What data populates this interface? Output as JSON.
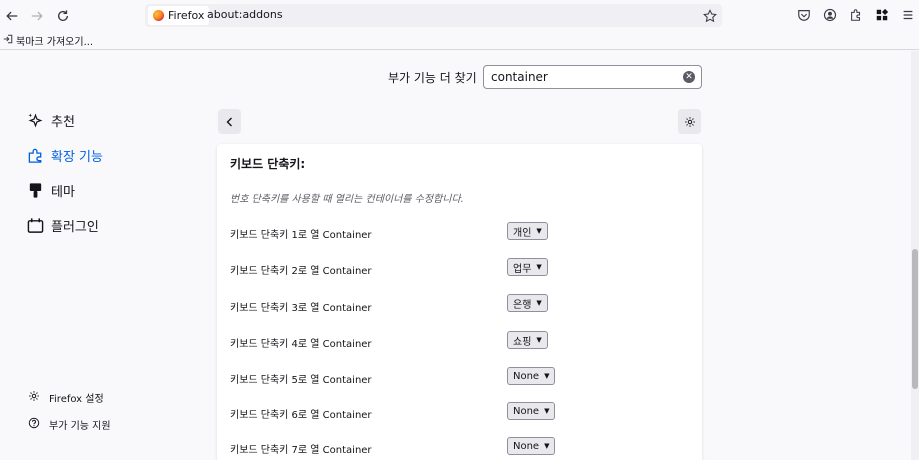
{
  "browser": {
    "identity_label": "Firefox",
    "url": "about:addons",
    "bookmark_item": "북마크 가져오기..."
  },
  "search": {
    "label": "부가 기능 더 찾기",
    "value": "container"
  },
  "sidebar": {
    "categories": [
      {
        "label": "추천",
        "icon": "sparkle-icon"
      },
      {
        "label": "확장 기능",
        "icon": "puzzle-icon",
        "active": true
      },
      {
        "label": "테마",
        "icon": "brush-icon"
      },
      {
        "label": "플러그인",
        "icon": "plugin-icon"
      }
    ],
    "footer": [
      {
        "label": "Firefox 설정",
        "icon": "gear-icon"
      },
      {
        "label": "부가 기능 지원",
        "icon": "help-icon"
      }
    ]
  },
  "card": {
    "title": "키보드 단축키:",
    "description": "번호 단축키를 사용할 때 열리는 컨테이너를 수정합니다.",
    "rows": [
      {
        "label": "키보드 단축키 1로 열 Container",
        "value": "개인"
      },
      {
        "label": "키보드 단축키 2로 열 Container",
        "value": "업무"
      },
      {
        "label": "키보드 단축키 3로 열 Container",
        "value": "은행"
      },
      {
        "label": "키보드 단축키 4로 열 Container",
        "value": "쇼핑"
      },
      {
        "label": "키보드 단축키 5로 열 Container",
        "value": "None"
      },
      {
        "label": "키보드 단축키 6로 열 Container",
        "value": "None"
      },
      {
        "label": "키보드 단축키 7로 열 Container",
        "value": "None"
      }
    ]
  },
  "colors": {
    "accent": "#0061e0",
    "background": "#f9f9fb"
  }
}
